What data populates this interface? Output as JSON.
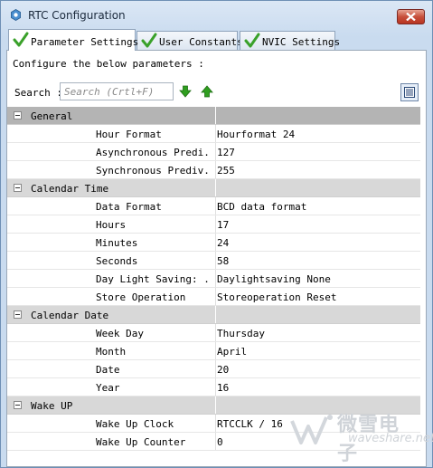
{
  "window": {
    "title": "RTC Configuration",
    "title_icon": "gear-icon"
  },
  "tabs": [
    {
      "label": "Parameter Settings",
      "active": true
    },
    {
      "label": "User Constants",
      "active": false
    },
    {
      "label": "NVIC Settings",
      "active": false
    }
  ],
  "main": {
    "configure_label": "Configure the below parameters :",
    "search_label": "Search :",
    "search_placeholder": "Search (Crtl+F)"
  },
  "groups": [
    {
      "title": "General",
      "params": [
        {
          "name": "Hour Format",
          "value": "Hourformat 24"
        },
        {
          "name": "Asynchronous Predi...",
          "value": "127"
        },
        {
          "name": "Synchronous Prediv...",
          "value": "255"
        }
      ]
    },
    {
      "title": "Calendar Time",
      "params": [
        {
          "name": "Data Format",
          "value": "BCD data format"
        },
        {
          "name": "Hours",
          "value": "17"
        },
        {
          "name": "Minutes",
          "value": "24"
        },
        {
          "name": "Seconds",
          "value": "58"
        },
        {
          "name": "Day Light Saving: ...",
          "value": "Daylightsaving None"
        },
        {
          "name": "Store Operation",
          "value": "Storeoperation Reset"
        }
      ]
    },
    {
      "title": "Calendar Date",
      "params": [
        {
          "name": "Week Day",
          "value": "Thursday"
        },
        {
          "name": "Month",
          "value": "April"
        },
        {
          "name": "Date",
          "value": "20"
        },
        {
          "name": "Year",
          "value": "16"
        }
      ]
    },
    {
      "title": "Wake UP",
      "params": [
        {
          "name": "Wake Up Clock",
          "value": "RTCCLK / 16"
        },
        {
          "name": "Wake Up Counter",
          "value": "0"
        }
      ]
    }
  ],
  "watermark": {
    "line1": "微雪电子",
    "line2": "waveshare.net"
  },
  "colors": {
    "check_green": "#3aa12a",
    "arrow_green": "#2f9e1f",
    "close_red": "#c7503b"
  }
}
